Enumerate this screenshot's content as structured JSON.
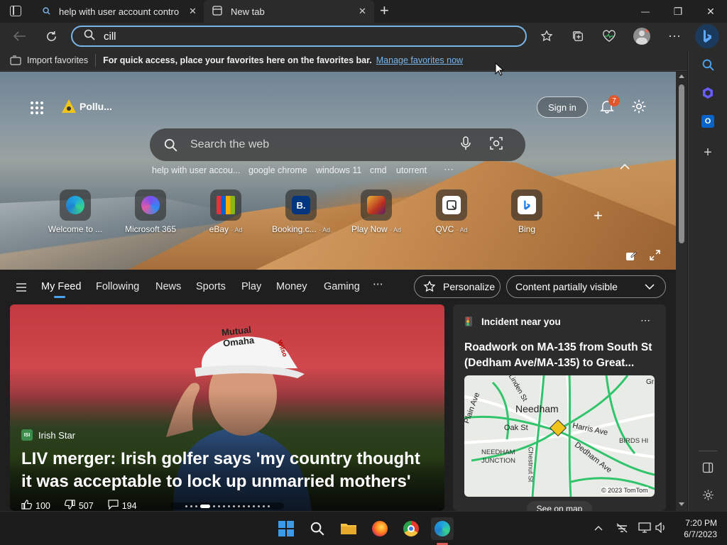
{
  "tabs": [
    {
      "title": "help with user account control im",
      "close": "✕"
    },
    {
      "title": "New tab",
      "close": "✕"
    }
  ],
  "window": {
    "minimize": "—",
    "restore": "❐",
    "close": "✕",
    "new_tab": "+"
  },
  "address": {
    "value": "cill",
    "placeholder": ""
  },
  "favorites_bar": {
    "import_label": "Import favorites",
    "message": "For quick access, place your favorites here on the favorites bar.",
    "manage_link": "Manage favorites now"
  },
  "hero": {
    "weather_label": "Pollu...",
    "sign_in": "Sign in",
    "notification_count": "7",
    "search_placeholder": "Search the web",
    "suggestions": [
      "help with user accou...",
      "google chrome",
      "windows 11",
      "cmd",
      "utorrent",
      "⋯"
    ],
    "quick_links": [
      {
        "label": "Welcome to ...",
        "ad": ""
      },
      {
        "label": "Microsoft 365",
        "ad": ""
      },
      {
        "label": "eBay",
        "ad": "· Ad"
      },
      {
        "label": "Booking.c...",
        "ad": "· Ad"
      },
      {
        "label": "Play Now",
        "ad": "· Ad"
      },
      {
        "label": "QVC",
        "ad": "· Ad"
      },
      {
        "label": "Bing",
        "ad": ""
      }
    ],
    "booking_letter": "B."
  },
  "feed_nav": {
    "tabs": [
      "My Feed",
      "Following",
      "News",
      "Sports",
      "Play",
      "Money",
      "Gaming"
    ],
    "more": "⋯",
    "personalize": "Personalize",
    "content_visibility": "Content partially visible"
  },
  "main_story": {
    "source": "Irish Star",
    "headline": "LIV merger: Irish golfer says 'my country thought it was acceptable to lock up unmarried mothers'",
    "likes": "100",
    "dislikes": "507",
    "comments": "194",
    "cap_text_1": "Mutual",
    "cap_text_2": "Omaha",
    "cap_text_3": "Wilso"
  },
  "side_card": {
    "title": "Incident near you",
    "headline": "Roadwork on MA-135 from South St (Dedham Ave/MA-135) to Great...",
    "map_labels": [
      "Needham",
      "Oak St",
      "Harris Ave",
      "NEEDHAM JUNCTION",
      "Chestnut St",
      "BIRDS HI",
      "Dedham Ave",
      "Plain Ave",
      "Linden St",
      "Gr"
    ],
    "map_credit": "© 2023 TomTom",
    "see_on_map": "See on map",
    "more": "⋯"
  },
  "taskbar": {
    "time": "7:20 PM",
    "date": "6/7/2023"
  },
  "colors": {
    "accent": "#7ab5e8",
    "link": "#7ab5e8",
    "badge": "#e0562d"
  }
}
